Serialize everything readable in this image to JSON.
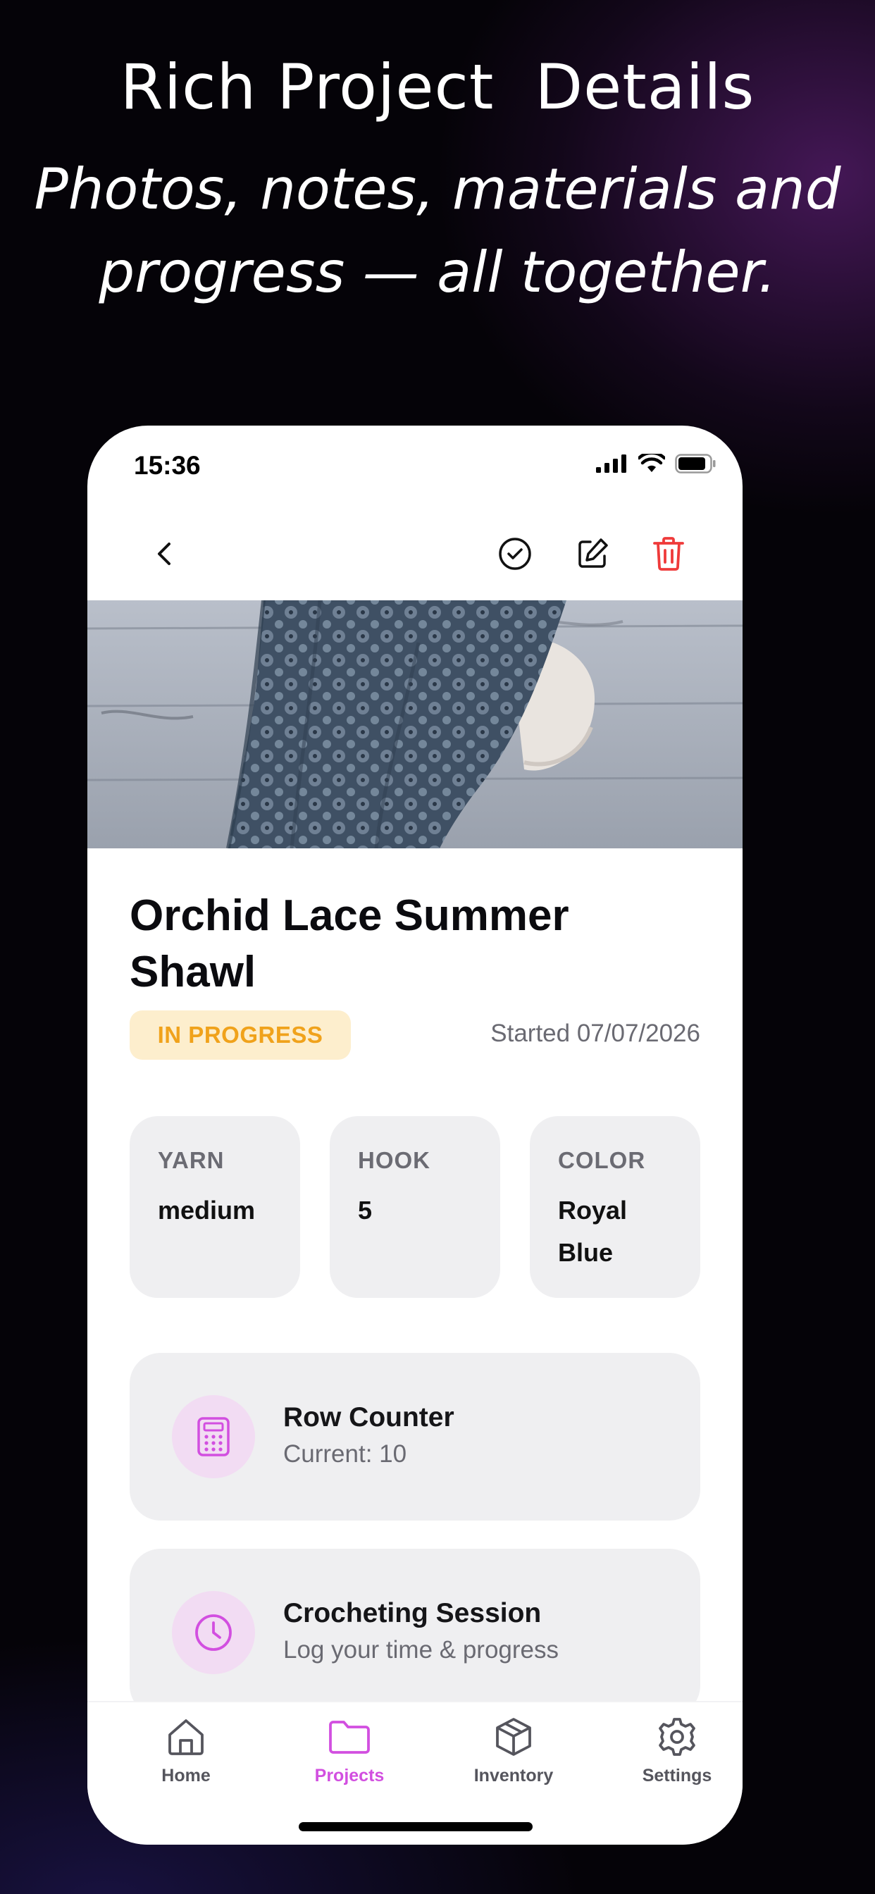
{
  "promo": {
    "title": "Rich Project  Details",
    "subtitle_line1": "Photos, notes, materials and",
    "subtitle_line2": "progress — all together."
  },
  "status_bar": {
    "time": "15:36"
  },
  "project": {
    "title": "Orchid Lace Summer Shawl",
    "status": "IN PROGRESS",
    "started": "Started 07/07/2026",
    "specs": [
      {
        "label": "YARN",
        "value": "medium"
      },
      {
        "label": "HOOK",
        "value": "5"
      },
      {
        "label": "COLOR",
        "value": "Royal Blue"
      }
    ]
  },
  "actions": [
    {
      "title": "Row Counter",
      "subtitle": "Current: 10",
      "icon": "calculator-icon"
    },
    {
      "title": "Crocheting Session",
      "subtitle": "Log your time & progress",
      "icon": "clock-icon"
    }
  ],
  "tabs": [
    {
      "label": "Home",
      "icon": "home-icon"
    },
    {
      "label": "Projects",
      "icon": "folder-icon",
      "active": true
    },
    {
      "label": "Inventory",
      "icon": "box-icon"
    },
    {
      "label": "Settings",
      "icon": "gear-icon"
    }
  ],
  "colors": {
    "accent": "#d24fe0",
    "status_badge_bg": "#fdeecd",
    "status_badge_text": "#f0a21b",
    "delete": "#ef3a3a",
    "card_bg": "#efeff1"
  }
}
